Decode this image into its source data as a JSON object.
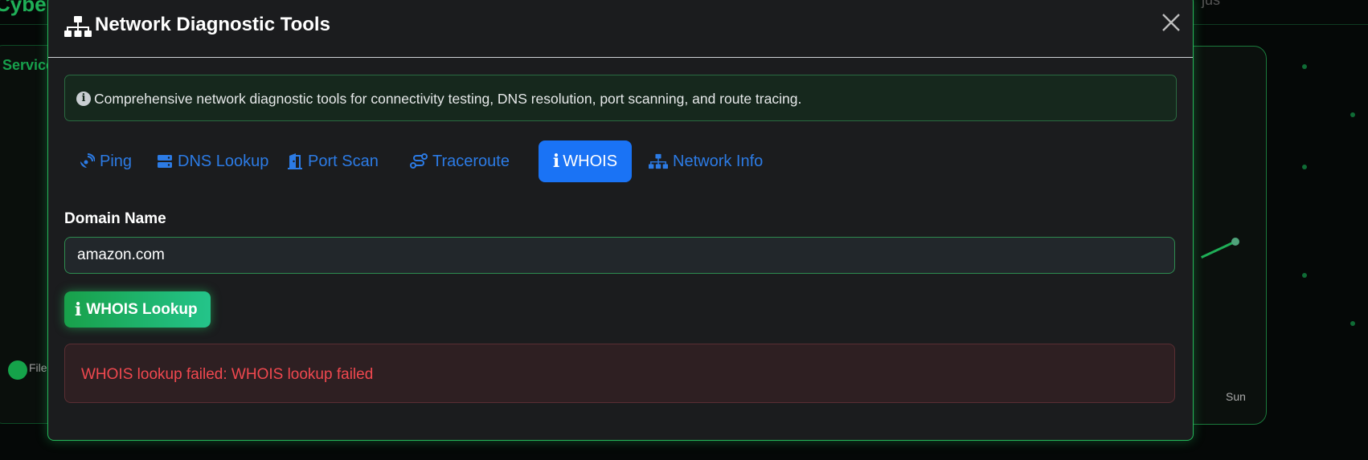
{
  "background": {
    "brand": "Cyber",
    "user": "jus",
    "left_card_title": "Service",
    "legend_label": "File",
    "axis_label_sun": "Sun"
  },
  "modal": {
    "title": "Network Diagnostic Tools",
    "title_icon": "network-wired-icon",
    "close_icon": "close-icon",
    "info_icon": "info-circle-icon",
    "info_text": "Comprehensive network diagnostic tools for connectivity testing, DNS resolution, port scanning, and route tracing.",
    "tabs": [
      {
        "label": "Ping",
        "icon": "satellite-dish-icon",
        "active": false
      },
      {
        "label": "DNS Lookup",
        "icon": "server-icon",
        "active": false
      },
      {
        "label": "Port Scan",
        "icon": "door-open-icon",
        "active": false
      },
      {
        "label": "Traceroute",
        "icon": "route-icon",
        "active": false
      },
      {
        "label": "WHOIS",
        "icon": "info-icon",
        "active": true
      },
      {
        "label": "Network Info",
        "icon": "network-wired-icon",
        "active": false
      }
    ],
    "field_label": "Domain Name",
    "domain_value": "amazon.com",
    "lookup_button": "WHOIS Lookup",
    "error_message": "WHOIS lookup failed: WHOIS lookup failed"
  },
  "colors": {
    "accent_green": "#22c55e",
    "tab_active": "#1a73f5",
    "tab_link": "#2c7be5",
    "error_text": "#f0484f"
  }
}
